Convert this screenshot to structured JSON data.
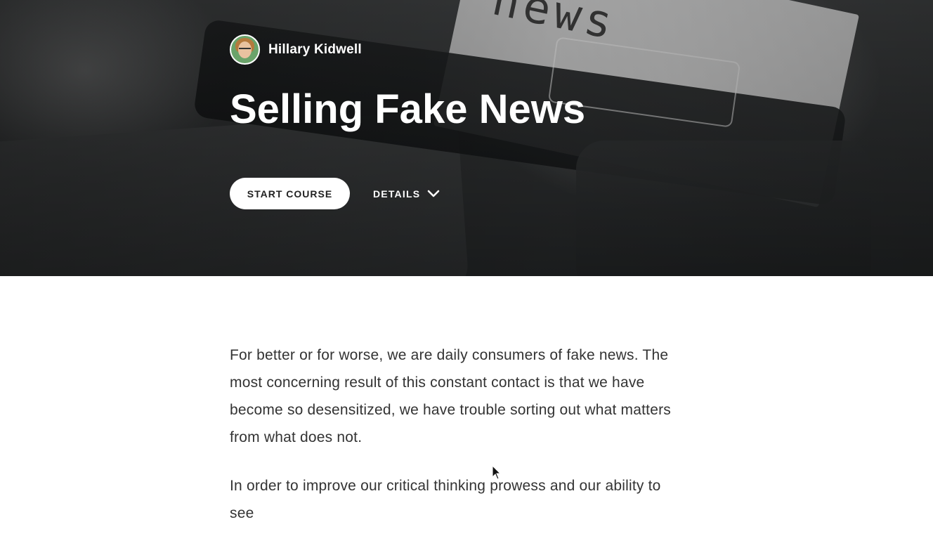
{
  "hero": {
    "author_name": "Hillary Kidwell",
    "title": "Selling Fake News",
    "start_label": "START COURSE",
    "details_label": "DETAILS",
    "background_word": "news"
  },
  "content": {
    "paragraphs": [
      "For better or for worse, we are daily consumers of fake news. The most concerning result of this constant contact is that we have become so desensitized, we have trouble sorting out what matters from what does not.",
      "In order to improve our critical thinking prowess and our ability to see"
    ]
  },
  "icons": {
    "details": "chevron-down-icon",
    "cursor": "mouse-pointer-icon"
  },
  "colors": {
    "hero_text": "#ffffff",
    "body_text": "#333333",
    "button_bg": "#ffffff"
  }
}
